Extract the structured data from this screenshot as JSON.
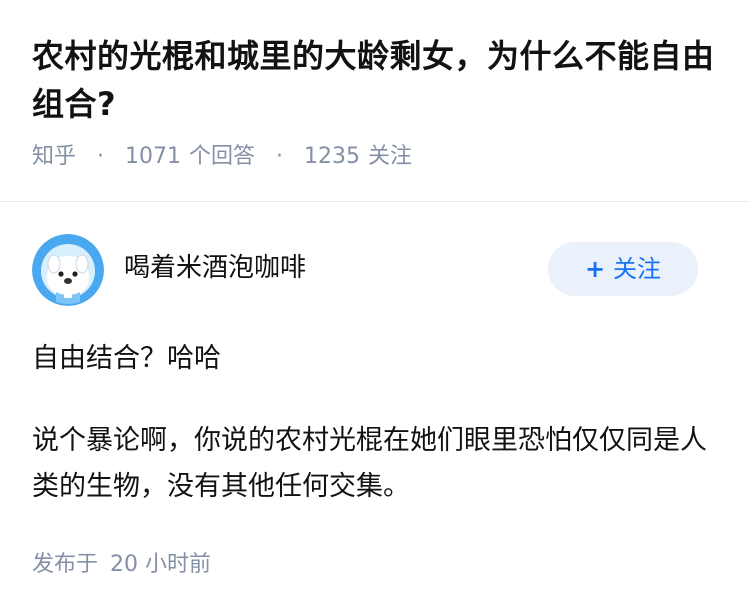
{
  "question": {
    "title": "农村的光棍和城里的大龄剩女，为什么不能自由组合?",
    "source": "知乎",
    "answers_count": "1071",
    "answers_label": "个回答",
    "followers_count": "1235",
    "followers_label": "关注",
    "separator": "·"
  },
  "author": {
    "name": "喝着米酒泡咖啡",
    "avatar_icon": "cartoon-dog-astronaut-avatar",
    "follow_plus": "+",
    "follow_label": "关注"
  },
  "answer": {
    "paragraphs": [
      "自由结合？哈哈",
      "说个暴论啊，你说的农村光棍在她们眼里恐怕仅仅同是人类的生物，没有其他任何交集。"
    ],
    "time_prefix": "发布于",
    "time_value": "20 小时前"
  },
  "colors": {
    "accent": "#1772f6",
    "follow_bg": "#eaf1fb",
    "meta_text": "#8590a6",
    "main_text": "#121212",
    "avatar_blue": "#4aa8f0"
  }
}
